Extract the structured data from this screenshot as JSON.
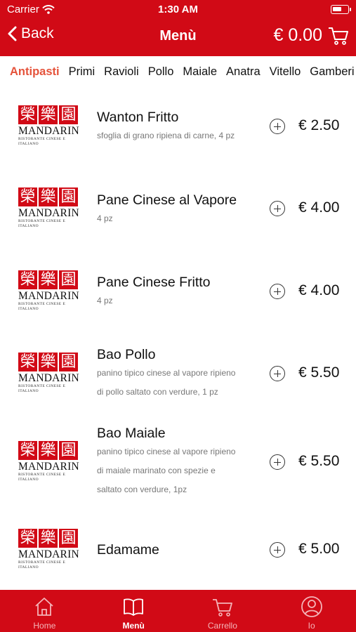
{
  "status_bar": {
    "carrier": "Carrier",
    "time": "1:30 AM"
  },
  "nav": {
    "back_label": "Back",
    "title": "Menù",
    "cart_total": "€ 0.00"
  },
  "categories": [
    "Antipasti",
    "Primi",
    "Ravioli",
    "Pollo",
    "Maiale",
    "Anatra",
    "Vitello",
    "Gamberi"
  ],
  "active_category": "Antipasti",
  "logo": {
    "chars": "榮樂園",
    "name": "MANDARIN",
    "subtitle": "Ristorante Cinese e Italiano"
  },
  "items": [
    {
      "name": "Wanton Fritto",
      "desc": [
        "sfoglia di grano ripiena di carne, 4 pz"
      ],
      "price": "€ 2.50"
    },
    {
      "name": "Pane Cinese al Vapore",
      "desc": [
        "4 pz"
      ],
      "price": "€ 4.00"
    },
    {
      "name": "Pane Cinese Fritto",
      "desc": [
        "4 pz"
      ],
      "price": "€ 4.00"
    },
    {
      "name": "Bao Pollo",
      "desc": [
        "panino tipico cinese al vapore ripieno",
        "di pollo saltato con verdure, 1 pz"
      ],
      "price": "€ 5.50"
    },
    {
      "name": "Bao Maiale",
      "desc": [
        "panino tipico cinese al vapore ripieno",
        "di maiale marinato con spezie e",
        "saltato con verdure, 1pz"
      ],
      "price": "€ 5.50"
    },
    {
      "name": "Edamame",
      "desc": [],
      "price": "€ 5.00"
    }
  ],
  "tab_bar": {
    "tabs": [
      {
        "label": "Home",
        "icon": "home-icon"
      },
      {
        "label": "Menù",
        "icon": "book-icon"
      },
      {
        "label": "Carrello",
        "icon": "cart-icon"
      },
      {
        "label": "Io",
        "icon": "user-icon"
      }
    ],
    "active": "Menù"
  },
  "colors": {
    "brand_red": "#d10a16",
    "active_category": "#e5533b"
  }
}
